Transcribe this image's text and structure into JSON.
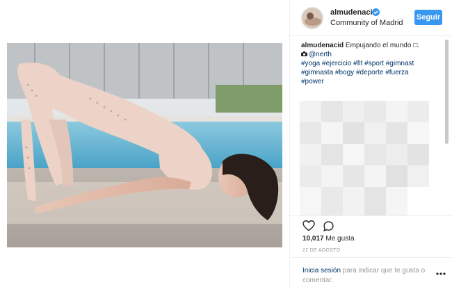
{
  "post": {
    "username": "almudenacid",
    "location": "Community of Madrid",
    "follow_label": "Seguir",
    "caption": {
      "username": "almudenacid",
      "text": "Empujando el mundo",
      "emoji": "□.",
      "photo_credit": "@nerth",
      "hashtags_line1": "#yoga #ejercicio #fit #sport #gimnast",
      "hashtags_line2": "#gimnasta #bogy #deporte #fuerza",
      "hashtags_line3": "#power"
    },
    "likes_count": "10,017",
    "likes_label": "Me gusta",
    "date": "22 DE AGOSTO",
    "login_link": "Inicia sesión",
    "login_rest": "para indicar que te gusta o comentar."
  },
  "colors": {
    "accent": "#3897f0",
    "link": "#003569",
    "muted": "#999999"
  },
  "icons": [
    "verified-badge-icon",
    "camera-icon",
    "heart-icon",
    "comment-icon",
    "more-options-icon"
  ]
}
